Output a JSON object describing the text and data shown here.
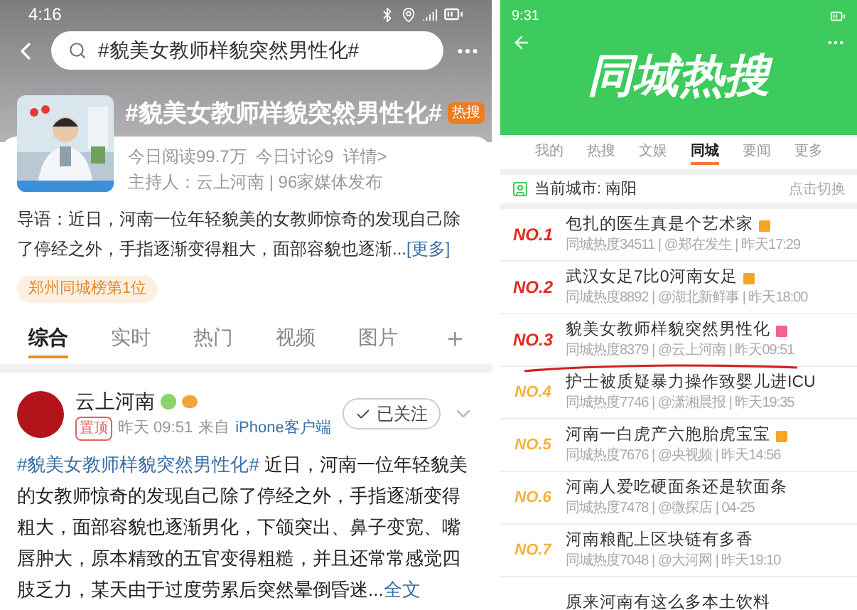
{
  "left": {
    "status_time": "4:16",
    "search": {
      "value": "#貌美女教师样貌突然男性化#"
    },
    "topic": {
      "title": "#貌美女教师样貌突然男性化#",
      "badge": "热搜",
      "stats": "今日阅读99.7万  今日讨论9  详情>",
      "host": "主持人：云上河南 | 96家媒体发布"
    },
    "intro": {
      "text": "导语：近日，河南一位年轻貌美的女教师惊奇的发现自己除了停经之外，手指逐渐变得粗大，面部容貌也逐渐...",
      "more": "[更多]"
    },
    "rank_tag": "郑州同城榜第1位",
    "tabs": [
      {
        "label": "综合",
        "selected": true
      },
      {
        "label": "实时",
        "selected": false
      },
      {
        "label": "热门",
        "selected": false
      },
      {
        "label": "视频",
        "selected": false
      },
      {
        "label": "图片",
        "selected": false
      }
    ],
    "add_tab": "+",
    "post": {
      "author": "云上河南",
      "pinned": "置顶",
      "time": "昨天 09:51",
      "source_prefix": "来自",
      "source": "iPhone客户端",
      "follow": "已关注",
      "hashtag": "#貌美女教师样貌突然男性化#",
      "body": " 近日，河南一位年轻貌美的女教师惊奇的发现自己除了停经之外，手指逐渐变得粗大，面部容貌也逐渐男化，下颌突出、鼻子变宽、嘴唇肿大，原本精致的五官变得粗糙，并且还常常感觉四肢乏力，某天由于过度劳累后突然晕倒昏迷...",
      "more": "全文"
    }
  },
  "right": {
    "status_time": "9:31",
    "banner_title": "同城热搜",
    "tabs": [
      {
        "label": "我的",
        "selected": false
      },
      {
        "label": "热搜",
        "selected": false
      },
      {
        "label": "文娱",
        "selected": false
      },
      {
        "label": "同城",
        "selected": true
      },
      {
        "label": "要闻",
        "selected": false
      },
      {
        "label": "更多",
        "selected": false
      }
    ],
    "city": "当前城市: 南阳",
    "switch": "点击切换",
    "items": [
      {
        "rank": "NO.1",
        "title": "包扎的医生真是个艺术家",
        "meta": "同城热度34511 | @郑在发生 | 昨天17:29",
        "color": "#f5a623",
        "top": true
      },
      {
        "rank": "NO.2",
        "title": "武汉女足7比0河南女足",
        "meta": "同城热度8892 | @湖北新鲜事 | 昨天18:00",
        "color": "#f5a623",
        "top": true
      },
      {
        "rank": "NO.3",
        "title": "貌美女教师样貌突然男性化",
        "meta": "同城热度8379 | @云上河南 | 昨天09:51",
        "color": "#f06292",
        "top": true
      },
      {
        "rank": "NO.4",
        "title": "护士被质疑暴力操作致婴儿进ICU",
        "meta": "同城热度7746 | @潇湘晨报 | 昨天19:35",
        "top": false
      },
      {
        "rank": "NO.5",
        "title": "河南一白虎产六胞胎虎宝宝",
        "meta": "同城热度7676 | @央视频 | 昨天14:56",
        "color": "#f5a623",
        "top": false
      },
      {
        "rank": "NO.6",
        "title": "河南人爱吃硬面条还是软面条",
        "meta": "同城热度7478 | @微探店 | 04-25",
        "top": false
      },
      {
        "rank": "NO.7",
        "title": "河南粮配上区块链有多香",
        "meta": "同城热度7048 | @大河网 | 昨天19:10",
        "top": false
      },
      {
        "title": "原来河南有这么多本土饮料"
      }
    ]
  }
}
